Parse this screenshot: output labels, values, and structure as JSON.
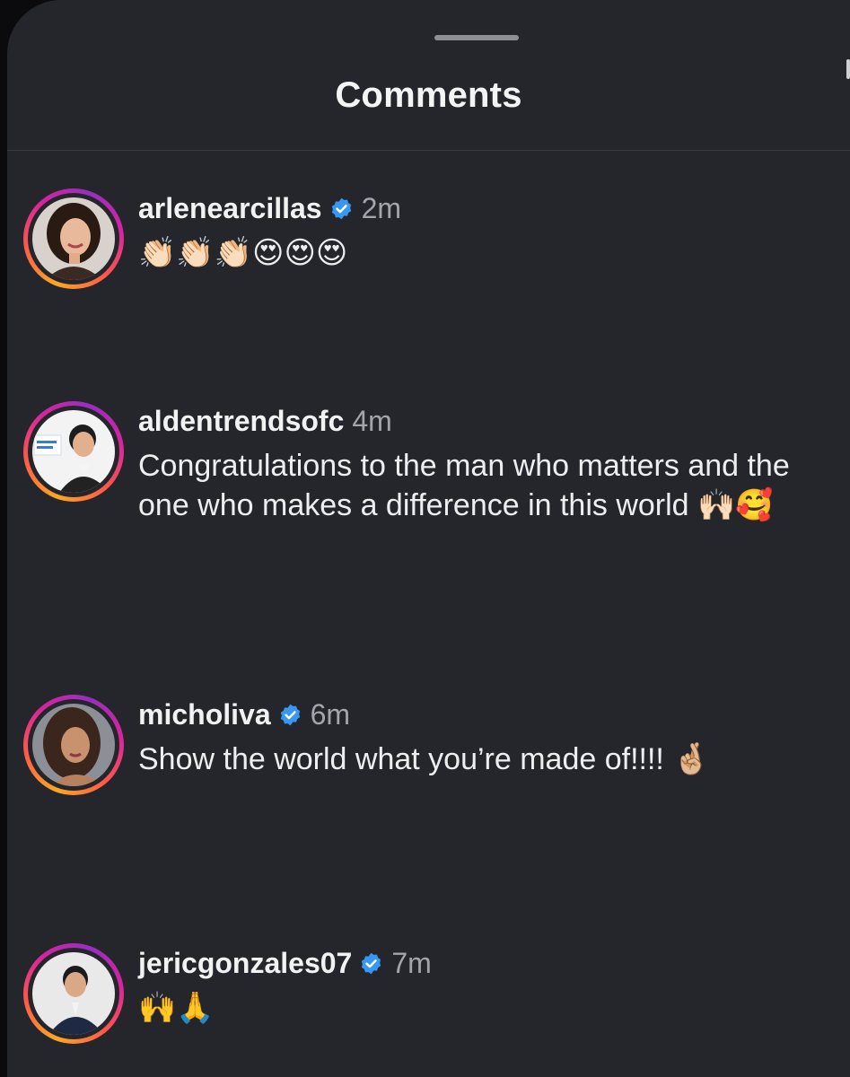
{
  "header": {
    "title": "Comments"
  },
  "icons": {
    "verified": "verified-badge-icon",
    "verified_color": "#3897f0",
    "story_ring": [
      "#f9a825",
      "#fd5949",
      "#d6249f",
      "#962fbf"
    ]
  },
  "comments": [
    {
      "username": "arlenearcillas",
      "verified": true,
      "time": "2m",
      "text": "👏🏻👏🏻👏🏻😍😍😍"
    },
    {
      "username": "aldentrendsofc",
      "verified": false,
      "time": "4m",
      "text": "Congratulations to the man who matters and the one who makes a difference in this world 🙌🏻🥰"
    },
    {
      "username": "micholiva",
      "verified": true,
      "time": "6m",
      "text": "Show the world what you’re made of!!!! 🤞🏼"
    },
    {
      "username": "jericgonzales07",
      "verified": true,
      "time": "7m",
      "text": "🙌🙏"
    }
  ]
}
